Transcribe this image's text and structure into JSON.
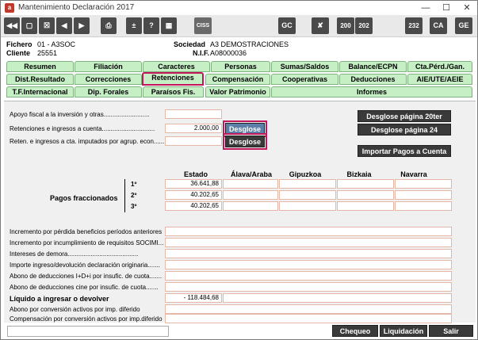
{
  "window": {
    "title": "Mantenimiento Declaración 2017",
    "icon": "app-icon"
  },
  "toolbar": {
    "buttons": [
      "nav-first",
      "prev",
      "close-box",
      "prev-record",
      "next-record",
      "print",
      "plus-minus",
      "help",
      "calculator",
      "CISS",
      "GC",
      "tools",
      "200",
      "202",
      "232",
      "CA",
      "GE"
    ]
  },
  "header": {
    "fichero_label": "Fichero",
    "fichero_value": "01 - A3SOC",
    "cliente_label": "Cliente",
    "cliente_value": "25551",
    "sociedad_label": "Sociedad",
    "sociedad_value": "A3 DEMOSTRACIONES",
    "nif_label": "N.I.F.",
    "nif_value": "A08000036"
  },
  "tabs": {
    "row1": [
      "Resumen",
      "Filiación",
      "Caracteres",
      "Personas",
      "Sumas/Saldos",
      "Balance/ECPN",
      "Cta.Pérd./Gan."
    ],
    "row2": [
      "Dist.Resultado",
      "Correcciones",
      "Retenciones",
      "Compensación",
      "Cooperativas",
      "Deducciones",
      "AIE/UTE/AEIE"
    ],
    "row3": [
      "T.F.Internacional",
      "Dip. Forales",
      "Paraísos Fis.",
      "Valor Patrimonio",
      "Informes"
    ],
    "active": "Retenciones"
  },
  "fields": {
    "apoyo_label": "Apoyo fiscal a la inversión y otras..........................",
    "apoyo_value": "",
    "retenciones_label": "Retenciones e  ingresos a cuenta..............................",
    "retenciones_value": "2.000,00",
    "reten_agrup_label": "Reten. e ingresos a cta. imputados por agrup. econ.........",
    "reten_agrup_value": ""
  },
  "buttons": {
    "desglose1": "Desglose",
    "desglose2": "Desglose",
    "desglose_20ter": "Desglose página 20ter",
    "desglose_24": "Desglose página 24",
    "importar": "Importar Pagos a Cuenta",
    "chequeo": "Chequeo",
    "liquidacion": "Liquidación",
    "salir": "Salir"
  },
  "grid": {
    "columns": [
      "Estado",
      "Álava/Araba",
      "Gipuzkoa",
      "Bizkaia",
      "Navarra"
    ],
    "section_label": "Pagos fraccionados",
    "rows": [
      {
        "label": "1º",
        "values": [
          "36.641,88",
          "",
          "",
          "",
          ""
        ]
      },
      {
        "label": "2º",
        "values": [
          "40.202,65",
          "",
          "",
          "",
          ""
        ]
      },
      {
        "label": "3º",
        "values": [
          "40.202,65",
          "",
          "",
          "",
          ""
        ]
      }
    ]
  },
  "lower_rows": [
    {
      "label": "Incremento por pérdida beneficios períodos anteriores",
      "value": ""
    },
    {
      "label": "Incremento por incumplimiento de requisitos SOCIMI...",
      "value": ""
    },
    {
      "label": "Intereses de demora........................................",
      "value": ""
    },
    {
      "label": "Importe ingreso/devolución declaración originaria.......",
      "value": ""
    },
    {
      "label": "Abono de deducciones I+D+i por insufic. de cuota.......",
      "value": ""
    },
    {
      "label": "Abono de deducciones  cine  por insufic. de cuota.......",
      "value": ""
    },
    {
      "label": "Líquido a ingresar o devolver",
      "value": "- 118.484,68",
      "bold": true
    },
    {
      "label": "Abono por conversión activos por imp. diferido",
      "value": ""
    },
    {
      "label": "Compensación por conversión activos por imp.diferido",
      "value": ""
    }
  ]
}
